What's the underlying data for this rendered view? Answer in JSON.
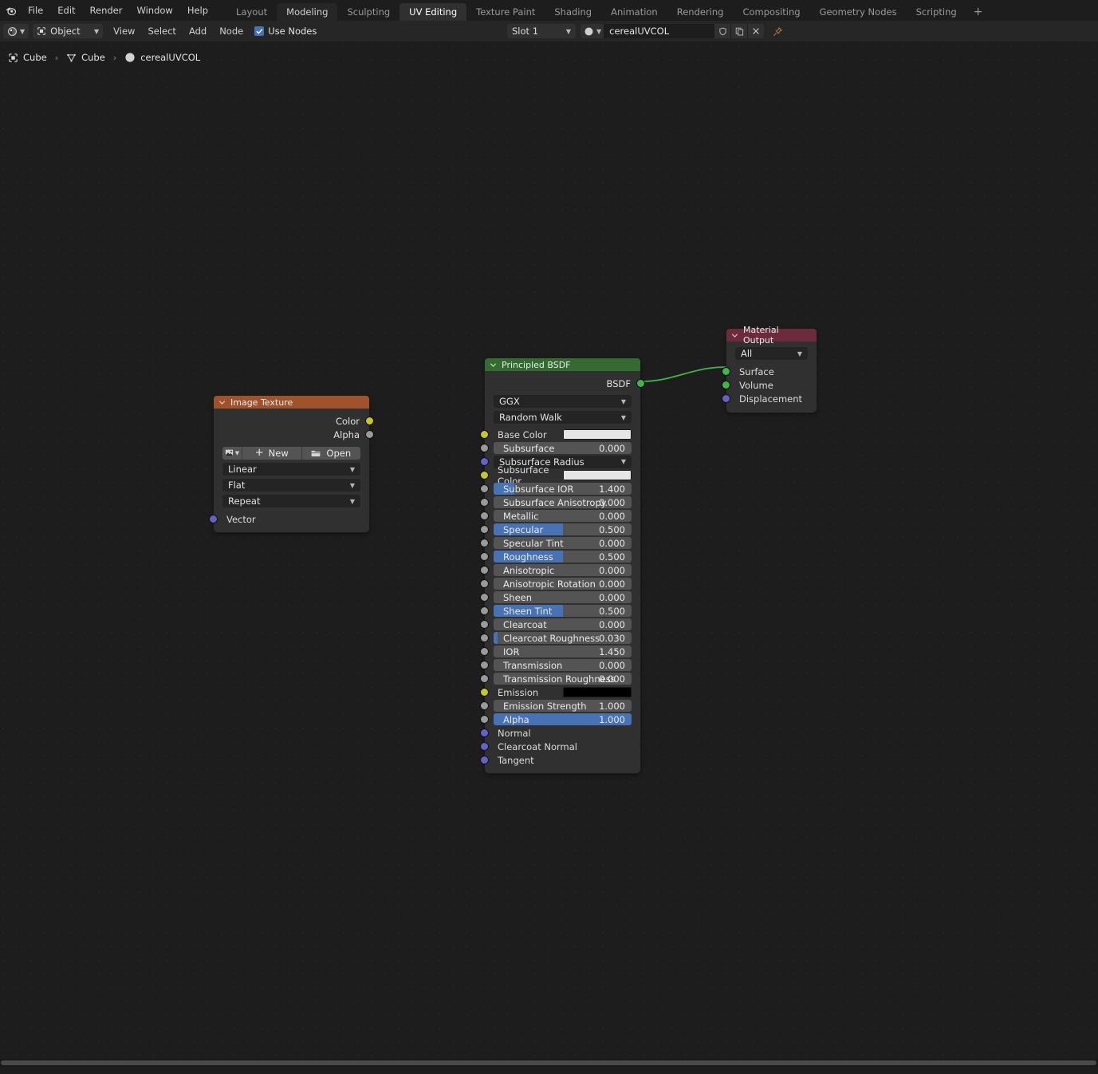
{
  "app": {
    "menus": [
      "File",
      "Edit",
      "Render",
      "Window",
      "Help"
    ],
    "workspace_tabs": [
      {
        "label": "Layout",
        "state": "normal"
      },
      {
        "label": "Modeling",
        "state": "hover"
      },
      {
        "label": "Sculpting",
        "state": "normal"
      },
      {
        "label": "UV Editing",
        "state": "active"
      },
      {
        "label": "Texture Paint",
        "state": "normal"
      },
      {
        "label": "Shading",
        "state": "normal"
      },
      {
        "label": "Animation",
        "state": "normal"
      },
      {
        "label": "Rendering",
        "state": "normal"
      },
      {
        "label": "Compositing",
        "state": "normal"
      },
      {
        "label": "Geometry Nodes",
        "state": "normal"
      },
      {
        "label": "Scripting",
        "state": "normal"
      }
    ],
    "add_workspace": "+"
  },
  "editor_header": {
    "editor_type_icon": "shader-editor-icon",
    "shader_type": "Object",
    "menus": [
      "View",
      "Select",
      "Add",
      "Node"
    ],
    "use_nodes_label": "Use Nodes",
    "use_nodes_checked": true,
    "slot": "Slot 1",
    "material_browse_icon": "material-sphere-icon",
    "material_name": "cerealUVCOL",
    "fake_user_icon": "shield-icon",
    "copy_icon": "duplicate-icon",
    "unlink_icon": "x-icon",
    "pin_icon": "pin-icon"
  },
  "breadcrumb": {
    "items": [
      {
        "label": "Cube",
        "icon": "object-icon"
      },
      {
        "label": "Cube",
        "icon": "mesh-data-icon"
      },
      {
        "label": "cerealUVCOL",
        "icon": "material-sphere-icon"
      }
    ],
    "separator": "›"
  },
  "nodes": {
    "image_texture": {
      "title": "Image Texture",
      "header_color": "#a0522d",
      "outputs": [
        {
          "label": "Color",
          "socket": "yellow"
        },
        {
          "label": "Alpha",
          "socket": "grey"
        }
      ],
      "datablock": {
        "browse_icon": "image-browse-icon",
        "new_label": "New",
        "open_icon": "folder-icon",
        "open_label": "Open",
        "plus_label": "+"
      },
      "dropdowns": [
        "Linear",
        "Flat",
        "Repeat"
      ],
      "inputs": [
        {
          "label": "Vector",
          "socket": "purple"
        }
      ]
    },
    "principled_bsdf": {
      "title": "Principled BSDF",
      "header_color": "#346b30",
      "outputs": [
        {
          "label": "BSDF",
          "socket": "green"
        }
      ],
      "dropdowns": [
        "GGX",
        "Random Walk"
      ],
      "properties": [
        {
          "label": "Base Color",
          "socket": "yellow",
          "type": "color",
          "color": "#e6e6e6"
        },
        {
          "label": "Subsurface",
          "socket": "grey",
          "type": "slider",
          "value": "0.000",
          "fill": 0
        },
        {
          "label": "Subsurface Radius",
          "socket": "purple",
          "type": "dropdown"
        },
        {
          "label": "Subsurface Color",
          "socket": "yellow",
          "type": "color",
          "color": "#e6e6e6"
        },
        {
          "label": "Subsurface IOR",
          "socket": "grey",
          "type": "slider",
          "value": "1.400",
          "fill": 15
        },
        {
          "label": "Subsurface Anisotropy",
          "socket": "grey",
          "type": "slider",
          "value": "0.000",
          "fill": 0
        },
        {
          "label": "Metallic",
          "socket": "grey",
          "type": "slider",
          "value": "0.000",
          "fill": 0
        },
        {
          "label": "Specular",
          "socket": "grey",
          "type": "slider",
          "value": "0.500",
          "fill": 50
        },
        {
          "label": "Specular Tint",
          "socket": "grey",
          "type": "slider",
          "value": "0.000",
          "fill": 0
        },
        {
          "label": "Roughness",
          "socket": "grey",
          "type": "slider",
          "value": "0.500",
          "fill": 50
        },
        {
          "label": "Anisotropic",
          "socket": "grey",
          "type": "slider",
          "value": "0.000",
          "fill": 0
        },
        {
          "label": "Anisotropic Rotation",
          "socket": "grey",
          "type": "slider",
          "value": "0.000",
          "fill": 0
        },
        {
          "label": "Sheen",
          "socket": "grey",
          "type": "slider",
          "value": "0.000",
          "fill": 0
        },
        {
          "label": "Sheen Tint",
          "socket": "grey",
          "type": "slider",
          "value": "0.500",
          "fill": 50
        },
        {
          "label": "Clearcoat",
          "socket": "grey",
          "type": "slider",
          "value": "0.000",
          "fill": 0
        },
        {
          "label": "Clearcoat Roughness",
          "socket": "grey",
          "type": "slider",
          "value": "0.030",
          "fill": 3
        },
        {
          "label": "IOR",
          "socket": "grey",
          "type": "slider",
          "value": "1.450",
          "fill": 0
        },
        {
          "label": "Transmission",
          "socket": "grey",
          "type": "slider",
          "value": "0.000",
          "fill": 0
        },
        {
          "label": "Transmission Roughness",
          "socket": "grey",
          "type": "slider",
          "value": "0.000",
          "fill": 0
        },
        {
          "label": "Emission",
          "socket": "yellow",
          "type": "color",
          "color": "#000000"
        },
        {
          "label": "Emission Strength",
          "socket": "grey",
          "type": "slider",
          "value": "1.000",
          "fill": 0
        },
        {
          "label": "Alpha",
          "socket": "grey",
          "type": "slider",
          "value": "1.000",
          "fill": 100
        },
        {
          "label": "Normal",
          "socket": "purple",
          "type": "input"
        },
        {
          "label": "Clearcoat Normal",
          "socket": "purple",
          "type": "input"
        },
        {
          "label": "Tangent",
          "socket": "purple",
          "type": "input"
        }
      ]
    },
    "material_output": {
      "title": "Material Output",
      "header_color": "#6b2b3d",
      "target": "All",
      "inputs": [
        {
          "label": "Surface",
          "socket": "green"
        },
        {
          "label": "Volume",
          "socket": "green"
        },
        {
          "label": "Displacement",
          "socket": "purple"
        }
      ]
    }
  },
  "link": {
    "color": "#3fb54a",
    "from": "Principled BSDF / BSDF",
    "to": "Material Output / Surface"
  }
}
